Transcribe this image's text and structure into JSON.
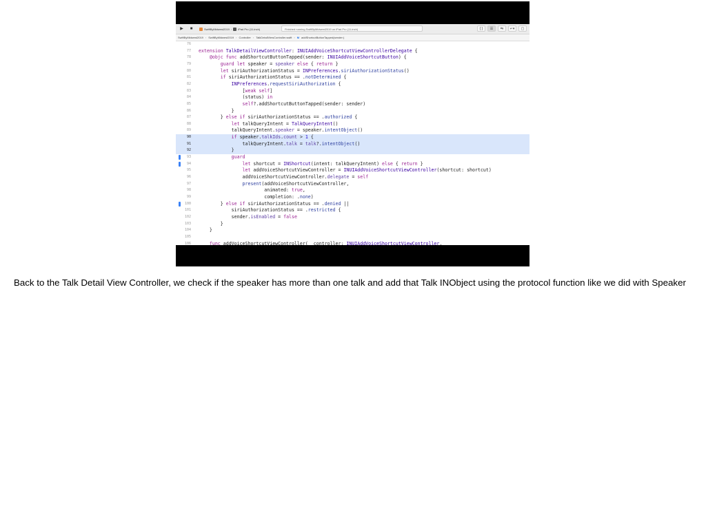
{
  "toolbar": {
    "run_glyph": "▶",
    "stop_glyph": "■",
    "scheme": "SwiftByMidwest2019",
    "device": "iPad Pro (11-inch)",
    "status": "Finished running SwiftByMidwest2019 on iPad Pro (11-inch)",
    "right_buttons": [
      "{ }",
      "☰",
      "⇆",
      "↵▾",
      "▢"
    ]
  },
  "jumpbar": {
    "items": [
      "SwiftByMidwest2019",
      "SwiftByMidwest2019",
      "Controller",
      "TalkDetailViewController.swift",
      "M",
      "addShortcutButtonTapped(sender:)"
    ]
  },
  "code_lines": [
    {
      "n": "76",
      "segments": [
        {
          "t": ""
        }
      ]
    },
    {
      "n": "77",
      "segments": [
        {
          "t": "extension ",
          "c": "kw"
        },
        {
          "t": "TalkDetailViewController",
          "c": "ty"
        },
        {
          "t": ": "
        },
        {
          "t": "INUIAddVoiceShortcutViewControllerDelegate",
          "c": "ty"
        },
        {
          "t": " {"
        }
      ]
    },
    {
      "n": "78",
      "segments": [
        {
          "t": "    "
        },
        {
          "t": "@objc func ",
          "c": "kw"
        },
        {
          "t": "addShortcutButtonTapped(sender: "
        },
        {
          "t": "INUIAddVoiceShortcutButton",
          "c": "ty"
        },
        {
          "t": ") {"
        }
      ]
    },
    {
      "n": "79",
      "segments": [
        {
          "t": "        "
        },
        {
          "t": "guard let ",
          "c": "kw"
        },
        {
          "t": "speaker = "
        },
        {
          "t": "speaker",
          "c": "pr"
        },
        {
          "t": " "
        },
        {
          "t": "else",
          "c": "kw"
        },
        {
          "t": " { "
        },
        {
          "t": "return",
          "c": "kw"
        },
        {
          "t": " }"
        }
      ]
    },
    {
      "n": "80",
      "segments": [
        {
          "t": "        "
        },
        {
          "t": "let ",
          "c": "kw"
        },
        {
          "t": "siriAuthorizationStatus = "
        },
        {
          "t": "INPreferences",
          "c": "ty"
        },
        {
          "t": "."
        },
        {
          "t": "siriAuthorizationStatus",
          "c": "fn"
        },
        {
          "t": "()"
        }
      ]
    },
    {
      "n": "81",
      "segments": [
        {
          "t": "        "
        },
        {
          "t": "if ",
          "c": "kw"
        },
        {
          "t": "siriAuthorizationStatus == ."
        },
        {
          "t": "notDetermined",
          "c": "fn"
        },
        {
          "t": " {"
        }
      ]
    },
    {
      "n": "82",
      "segments": [
        {
          "t": "            "
        },
        {
          "t": "INPreferences",
          "c": "ty"
        },
        {
          "t": "."
        },
        {
          "t": "requestSiriAuthorization",
          "c": "fn"
        },
        {
          "t": " {"
        }
      ]
    },
    {
      "n": "83",
      "segments": [
        {
          "t": "                ["
        },
        {
          "t": "weak self",
          "c": "kw"
        },
        {
          "t": "]"
        }
      ]
    },
    {
      "n": "84",
      "segments": [
        {
          "t": "                (status) "
        },
        {
          "t": "in",
          "c": "kw"
        }
      ]
    },
    {
      "n": "85",
      "segments": [
        {
          "t": "                "
        },
        {
          "t": "self",
          "c": "kw"
        },
        {
          "t": "?.addShortcutButtonTapped(sender: sender)"
        }
      ]
    },
    {
      "n": "86",
      "segments": [
        {
          "t": "            }"
        }
      ]
    },
    {
      "n": "87",
      "segments": [
        {
          "t": "        } "
        },
        {
          "t": "else if ",
          "c": "kw"
        },
        {
          "t": "siriAuthorizationStatus == ."
        },
        {
          "t": "authorized",
          "c": "fn"
        },
        {
          "t": " {"
        }
      ]
    },
    {
      "n": "88",
      "segments": [
        {
          "t": "            "
        },
        {
          "t": "let ",
          "c": "kw"
        },
        {
          "t": "talkQueryIntent = "
        },
        {
          "t": "TalkQueryIntent",
          "c": "ty"
        },
        {
          "t": "()"
        }
      ]
    },
    {
      "n": "89",
      "segments": [
        {
          "t": "            talkQueryIntent."
        },
        {
          "t": "speaker",
          "c": "pr"
        },
        {
          "t": " = speaker."
        },
        {
          "t": "intentObject",
          "c": "fn"
        },
        {
          "t": "()"
        }
      ]
    },
    {
      "n": "90",
      "hl": true,
      "segments": [
        {
          "t": "            "
        },
        {
          "t": "if ",
          "c": "kw"
        },
        {
          "t": "speaker."
        },
        {
          "t": "talkIds",
          "c": "pr"
        },
        {
          "t": "."
        },
        {
          "t": "count",
          "c": "pr"
        },
        {
          "t": " > "
        },
        {
          "t": "1",
          "c": "nm"
        },
        {
          "t": " {"
        }
      ]
    },
    {
      "n": "91",
      "hl": true,
      "segments": [
        {
          "t": "                talkQueryIntent."
        },
        {
          "t": "talk",
          "c": "pr"
        },
        {
          "t": " = "
        },
        {
          "t": "talk",
          "c": "pr"
        },
        {
          "t": "?."
        },
        {
          "t": "intentObject",
          "c": "fn"
        },
        {
          "t": "()"
        }
      ]
    },
    {
      "n": "92",
      "hl": true,
      "segments": [
        {
          "t": "            }"
        }
      ]
    },
    {
      "n": "93",
      "segments": [
        {
          "t": "            "
        },
        {
          "t": "guard",
          "c": "kw"
        }
      ]
    },
    {
      "n": "94",
      "segments": [
        {
          "t": "                "
        },
        {
          "t": "let ",
          "c": "kw"
        },
        {
          "t": "shortcut = "
        },
        {
          "t": "INShortcut",
          "c": "ty"
        },
        {
          "t": "(intent: talkQueryIntent) "
        },
        {
          "t": "else",
          "c": "kw"
        },
        {
          "t": " { "
        },
        {
          "t": "return",
          "c": "kw"
        },
        {
          "t": " }"
        }
      ]
    },
    {
      "n": "95",
      "segments": [
        {
          "t": "                "
        },
        {
          "t": "let ",
          "c": "kw"
        },
        {
          "t": "addVoiceShortcutViewController = "
        },
        {
          "t": "INUIAddVoiceShortcutViewController",
          "c": "ty"
        },
        {
          "t": "(shortcut: shortcut)"
        }
      ]
    },
    {
      "n": "96",
      "segments": [
        {
          "t": "                addVoiceShortcutViewController."
        },
        {
          "t": "delegate",
          "c": "pr"
        },
        {
          "t": " = "
        },
        {
          "t": "self",
          "c": "kw"
        }
      ]
    },
    {
      "n": "97",
      "segments": [
        {
          "t": "                "
        },
        {
          "t": "present",
          "c": "fn"
        },
        {
          "t": "(addVoiceShortcutViewController,"
        }
      ]
    },
    {
      "n": "98",
      "segments": [
        {
          "t": "                        animated: "
        },
        {
          "t": "true",
          "c": "kw"
        },
        {
          "t": ","
        }
      ]
    },
    {
      "n": "99",
      "segments": [
        {
          "t": "                        completion: ."
        },
        {
          "t": "none",
          "c": "fn"
        },
        {
          "t": ")"
        }
      ]
    },
    {
      "n": "100",
      "segments": [
        {
          "t": "        } "
        },
        {
          "t": "else if ",
          "c": "kw"
        },
        {
          "t": "siriAuthorizationStatus == ."
        },
        {
          "t": "denied",
          "c": "fn"
        },
        {
          "t": " ||"
        }
      ]
    },
    {
      "n": "101",
      "segments": [
        {
          "t": "            siriAuthorizationStatus == ."
        },
        {
          "t": "restricted",
          "c": "fn"
        },
        {
          "t": " {"
        }
      ]
    },
    {
      "n": "102",
      "segments": [
        {
          "t": "            sender."
        },
        {
          "t": "isEnabled",
          "c": "pr"
        },
        {
          "t": " = "
        },
        {
          "t": "false",
          "c": "kw"
        }
      ]
    },
    {
      "n": "103",
      "segments": [
        {
          "t": "        }"
        }
      ]
    },
    {
      "n": "104",
      "segments": [
        {
          "t": "    }"
        }
      ]
    },
    {
      "n": "105",
      "segments": [
        {
          "t": ""
        }
      ]
    },
    {
      "n": "106",
      "segments": [
        {
          "t": "    "
        },
        {
          "t": "func ",
          "c": "kw"
        },
        {
          "t": "addVoiceShortcutViewController(_ controller: "
        },
        {
          "t": "INUIAddVoiceShortcutViewController",
          "c": "ty"
        },
        {
          "t": ","
        }
      ]
    }
  ],
  "caption": "Back to the Talk Detail View Controller, we check if the speaker has more than one talk and add that Talk INObject using the protocol function like we did with Speaker",
  "colors": {
    "highlight": "#d9e6fb",
    "keyword": "#9b2393",
    "type": "#3900a0",
    "change_marker": "#3b82f6"
  }
}
